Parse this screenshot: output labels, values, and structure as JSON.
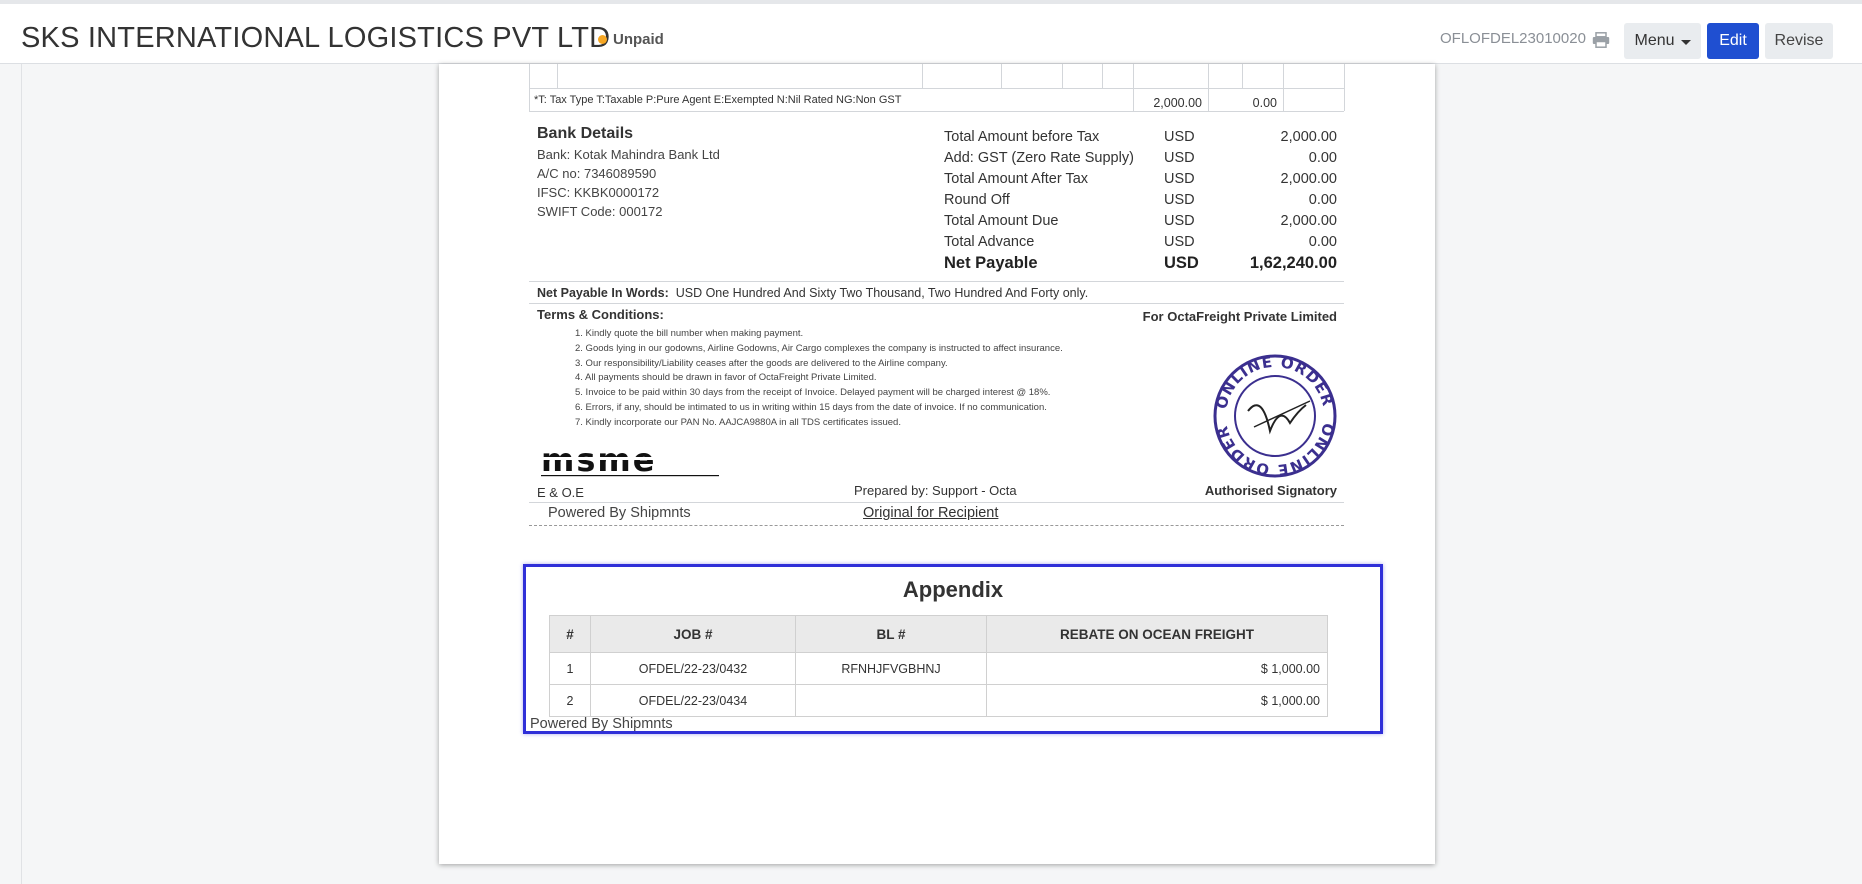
{
  "header": {
    "company": "SKS INTERNATIONAL LOGISTICS PVT LTD",
    "status": "Unpaid",
    "invoice_no": "OFLOFDEL23010020",
    "menu_label": "Menu",
    "edit_label": "Edit",
    "revise_label": "Revise",
    "status_color": "#f5a623",
    "accent_color": "#1f4fd1"
  },
  "tax_row": {
    "legend": "*T: Tax Type T:Taxable P:Pure Agent E:Exempted N:Nil Rated NG:Non GST",
    "taxable": "2,000.00",
    "tax": "0.00"
  },
  "bank": {
    "title": "Bank Details",
    "bank": "Bank: Kotak Mahindra Bank Ltd",
    "ac": "A/C no: 7346089590",
    "ifsc": "IFSC: KKBK0000172",
    "swift": "SWIFT Code: 000172"
  },
  "totals": [
    {
      "label": "Total Amount before Tax",
      "cur": "USD",
      "amount": "2,000.00"
    },
    {
      "label": "Add: GST (Zero Rate Supply)",
      "cur": "USD",
      "amount": "0.00"
    },
    {
      "label": "Total Amount After Tax",
      "cur": "USD",
      "amount": "2,000.00"
    },
    {
      "label": "Round Off",
      "cur": "USD",
      "amount": "0.00"
    },
    {
      "label": "Total Amount Due",
      "cur": "USD",
      "amount": "2,000.00"
    },
    {
      "label": "Total Advance",
      "cur": "USD",
      "amount": "0.00"
    },
    {
      "label": "Net Payable",
      "cur": "USD",
      "amount": "1,62,240.00"
    }
  ],
  "words": {
    "label": "Net Payable In Words:",
    "value": "USD One Hundred And Sixty Two Thousand, Two Hundred And Forty only."
  },
  "terms": {
    "title": "Terms & Conditions:",
    "for_company": "For OctaFreight Private Limited",
    "items": [
      "1. Kindly quote the bill number when making payment.",
      "2. Goods lying in our godowns, Airline Godowns, Air Cargo complexes the company is instructed to affect insurance.",
      "3. Our responsibility/Liability ceases after the goods are delivered to the Airline company.",
      "4. All payments should be drawn in favor of OctaFreight Private Limited.",
      "5. Invoice to be paid within 30 days from the receipt of Invoice. Delayed payment will be charged interest @ 18%.",
      "6. Errors, if any, should be intimated to us in writing within 15 days from the date of invoice. If no communication.",
      "7. Kindly incorporate our PAN No. AAJCA9880A in all TDS certificates issued."
    ]
  },
  "footer": {
    "msme": "msme",
    "stamp_text": "ONLINE ORDER",
    "eoe": "E & O.E",
    "prepared": "Prepared by: Support - Octa",
    "signatory": "Authorised Signatory",
    "powered": "Powered By Shipmnts",
    "original": "Original for Recipient"
  },
  "appendix": {
    "title": "Appendix",
    "columns": [
      "#",
      "JOB #",
      "BL #",
      "REBATE ON OCEAN FREIGHT"
    ],
    "rows": [
      [
        "1",
        "OFDEL/22-23/0432",
        "RFNHJFVGBHNJ",
        "$ 1,000.00"
      ],
      [
        "2",
        "OFDEL/22-23/0434",
        "",
        "$ 1,000.00"
      ]
    ],
    "powered": "Powered By Shipmnts"
  }
}
